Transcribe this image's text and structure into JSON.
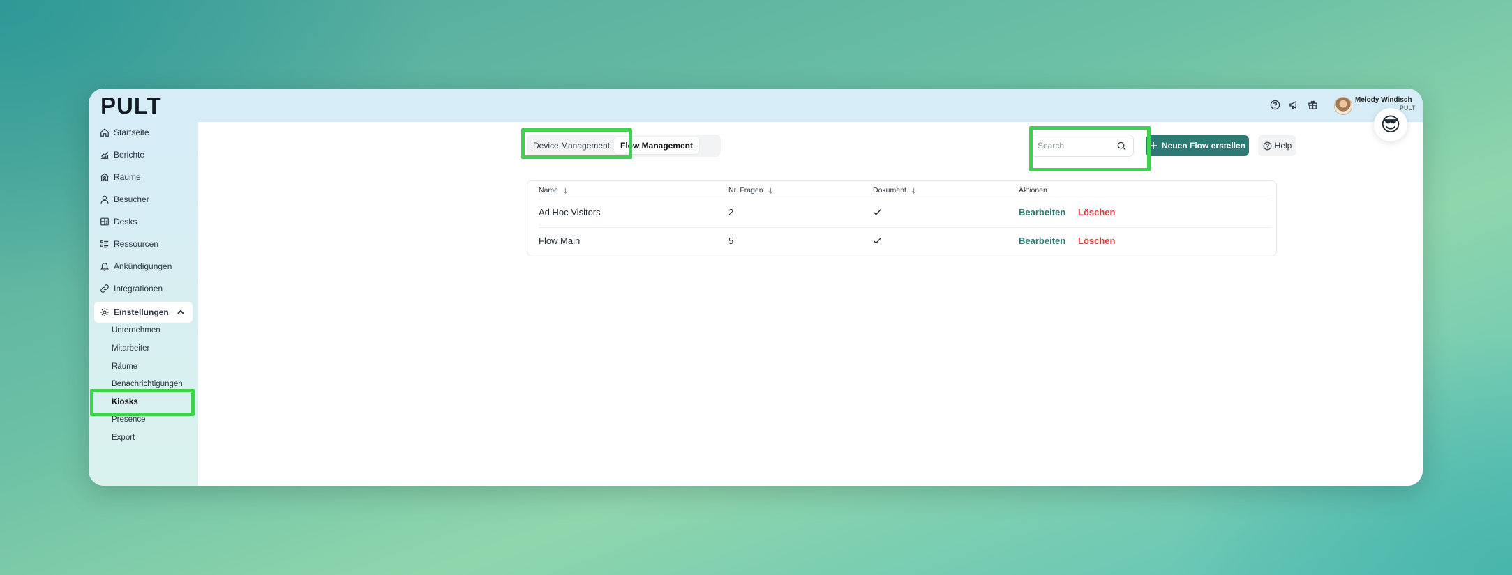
{
  "app": {
    "logo": "PULT"
  },
  "user": {
    "name": "Melody Windisch",
    "org": "PULT"
  },
  "emoji": "😎",
  "sidebar": {
    "items": [
      {
        "label": "Startseite",
        "icon": "home-icon"
      },
      {
        "label": "Berichte",
        "icon": "chart-icon"
      },
      {
        "label": "Räume",
        "icon": "rooms-icon"
      },
      {
        "label": "Besucher",
        "icon": "user-icon"
      },
      {
        "label": "Desks",
        "icon": "desk-icon"
      },
      {
        "label": "Ressourcen",
        "icon": "list-icon"
      },
      {
        "label": "Ankündigungen",
        "icon": "bell-icon"
      },
      {
        "label": "Integrationen",
        "icon": "link-icon"
      },
      {
        "label": "Einstellungen",
        "icon": "gear-icon"
      }
    ],
    "sub_items": [
      "Unternehmen",
      "Mitarbeiter",
      "Räume",
      "Benachrichtigungen",
      "Kiosks",
      "Presence",
      "Export"
    ]
  },
  "tabs": [
    {
      "label": "Device Management"
    },
    {
      "label": "Flow Management"
    }
  ],
  "search": {
    "placeholder": "Search"
  },
  "buttons": {
    "new_flow": "Neuen Flow erstellen",
    "help": "Help"
  },
  "table": {
    "columns": [
      "Name",
      "Nr. Fragen",
      "Dokument",
      "Aktionen"
    ],
    "rows": [
      {
        "name": "Ad Hoc Visitors",
        "questions": "2",
        "document": true,
        "edit": "Bearbeiten",
        "delete": "Löschen"
      },
      {
        "name": "Flow Main",
        "questions": "5",
        "document": true,
        "edit": "Bearbeiten",
        "delete": "Löschen"
      }
    ]
  },
  "colors": {
    "accent": "#2d7a74",
    "danger": "#e03a3a",
    "highlight": "#3ed24e"
  }
}
